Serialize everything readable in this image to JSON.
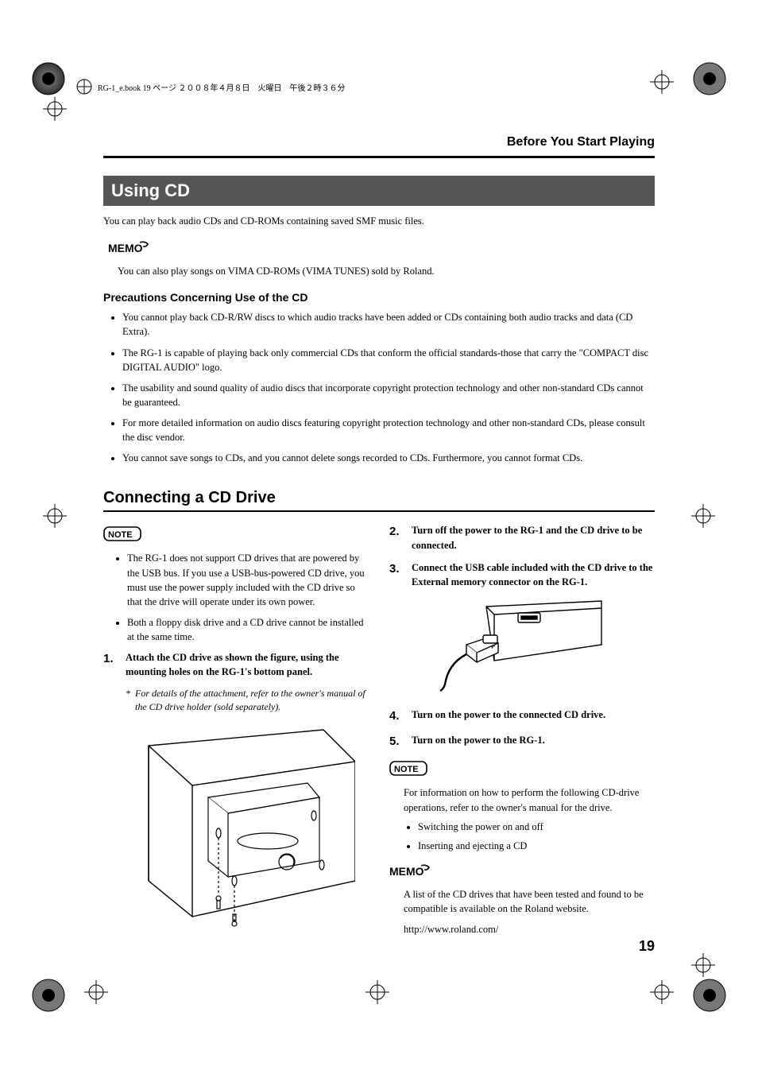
{
  "header_line": "RG-1_e.book  19 ページ  ２００８年４月８日　火曜日　午後２時３６分",
  "running_head": "Before You Start Playing",
  "h1": "Using CD",
  "intro": "You can play back audio CDs and CD-ROMs containing saved SMF music files.",
  "memo1": "You can also play songs on VIMA CD-ROMs (VIMA TUNES) sold by Roland.",
  "precautions_title": "Precautions Concerning Use of the CD",
  "precautions": [
    "You cannot play back CD-R/RW discs to which audio tracks have been added or CDs containing both audio tracks and data (CD Extra).",
    "The RG-1 is capable of playing back only commercial CDs that conform the official standards-those that carry the \"COMPACT disc DIGITAL AUDIO\" logo.",
    "The usability and sound quality of audio discs that incorporate copyright protection technology and other non-standard CDs cannot be guaranteed.",
    "For more detailed information on audio discs featuring copyright protection technology and other non-standard CDs, please consult the disc vendor.",
    "You cannot save songs to CDs, and you cannot delete songs recorded to CDs. Furthermore, you cannot format CDs."
  ],
  "h2": "Connecting a CD Drive",
  "note1_items": [
    "The RG-1 does not support CD drives that are powered by the USB bus. If you use a USB-bus-powered CD drive, you must use the power supply included with the CD drive so that the drive will operate under its own power.",
    "Both a floppy disk drive and a CD drive cannot be installed at the same time."
  ],
  "step1": "Attach the CD drive as shown the figure, using the mounting holes on the RG-1's bottom panel.",
  "step1_footnote": "For details of the attachment, refer to the owner's manual of the CD drive holder (sold separately).",
  "step2": "Turn off the power to the RG-1 and the CD drive to be connected.",
  "step3": "Connect the USB cable included with the CD drive to the External memory connector on the RG-1.",
  "step4": "Turn on the power to the connected CD drive.",
  "step5": "Turn on the power to the RG-1.",
  "note2_lead": "For information on how to perform the following CD-drive operations, refer to the owner's manual for the drive.",
  "note2_items": [
    "Switching the power on and off",
    "Inserting and ejecting a CD"
  ],
  "memo2_a": "A list of the CD drives that have been tested and found to be compatible is available on the Roland website.",
  "memo2_b": "http://www.roland.com/",
  "page_number": "19",
  "labels": {
    "memo": "MEMO",
    "note": "NOTE"
  }
}
